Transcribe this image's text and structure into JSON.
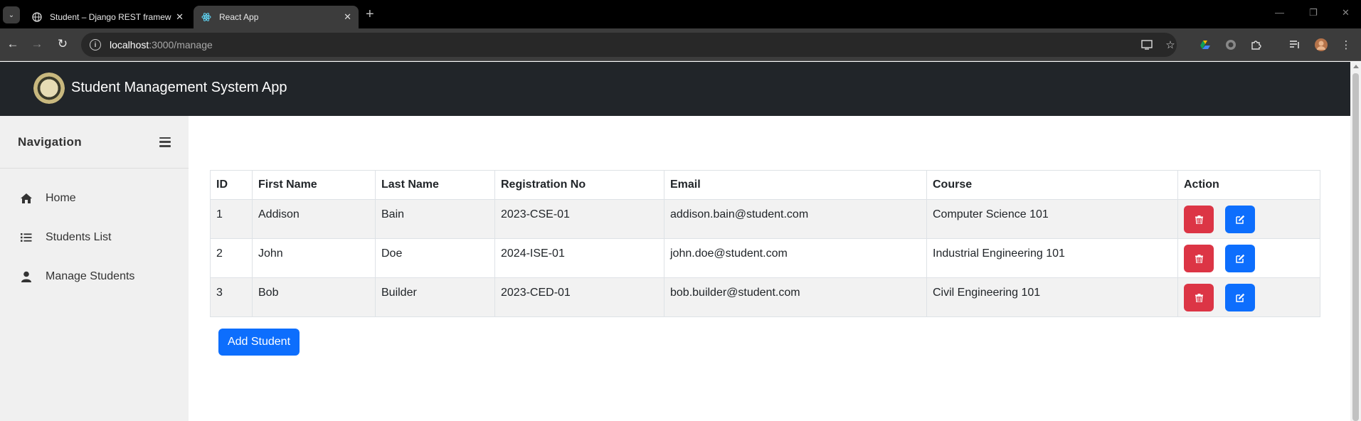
{
  "browser": {
    "tabs": [
      {
        "title": "Student – Django REST framew",
        "active": false
      },
      {
        "title": "React App",
        "active": true
      }
    ],
    "url_host": "localhost",
    "url_path": ":3000/manage"
  },
  "header": {
    "brand": "Student Management System App"
  },
  "sidebar": {
    "title": "Navigation",
    "items": [
      {
        "label": "Home",
        "icon": "home-icon"
      },
      {
        "label": "Students List",
        "icon": "list-icon"
      },
      {
        "label": "Manage Students",
        "icon": "user-icon"
      }
    ]
  },
  "table": {
    "columns": [
      "ID",
      "First Name",
      "Last Name",
      "Registration No",
      "Email",
      "Course",
      "Action"
    ],
    "rows": [
      {
        "id": "1",
        "first_name": "Addison",
        "last_name": "Bain",
        "registration_no": "2023-CSE-01",
        "email": "addison.bain@student.com",
        "course": "Computer Science 101"
      },
      {
        "id": "2",
        "first_name": "John",
        "last_name": "Doe",
        "registration_no": "2024-ISE-01",
        "email": "john.doe@student.com",
        "course": "Industrial Engineering 101"
      },
      {
        "id": "3",
        "first_name": "Bob",
        "last_name": "Builder",
        "registration_no": "2023-CED-01",
        "email": "bob.builder@student.com",
        "course": "Civil Engineering 101"
      }
    ]
  },
  "add_button": "Add Student",
  "colors": {
    "header_bg": "#212529",
    "primary": "#0d6efd",
    "danger": "#dc3545",
    "sidebar_bg": "#f0f0f0"
  }
}
